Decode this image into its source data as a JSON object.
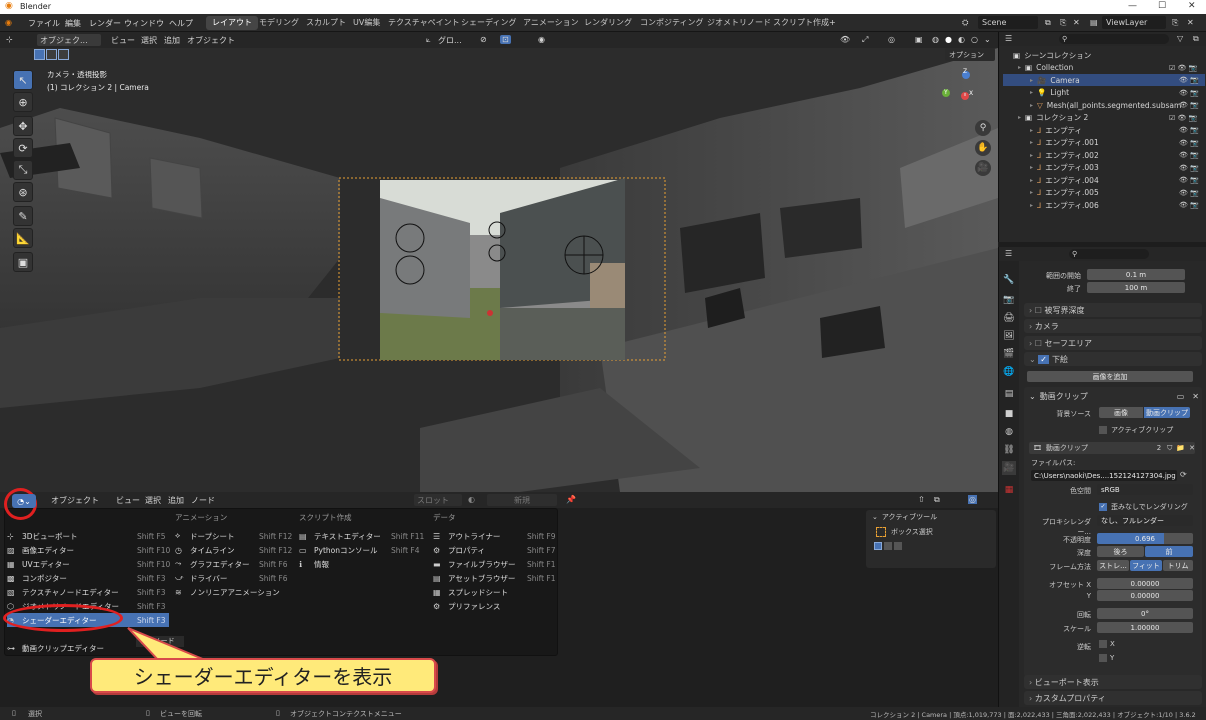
{
  "titlebar": {
    "app": "Blender"
  },
  "topmenu": {
    "file": "ファイル",
    "edit": "編集",
    "render": "レンダー",
    "window": "ウィンドウ",
    "help": "ヘルプ"
  },
  "workspaces": [
    "レイアウト",
    "モデリング",
    "スカルプト",
    "UV編集",
    "テクスチャペイント",
    "シェーディング",
    "アニメーション",
    "レンダリング",
    "コンポジティング",
    "ジオメトリノード",
    "スクリプト作成"
  ],
  "scene": {
    "name": "Scene",
    "viewlayer": "ViewLayer",
    "plus": "+"
  },
  "viewport": {
    "mode": "オブジェク...",
    "view": "ビュー",
    "select": "選択",
    "add": "追加",
    "object": "オブジェクト",
    "transform": "グロ...",
    "options": "オプション",
    "info_line1": "カメラ・透視投影",
    "info_line2": "(1) コレクション 2 | Camera"
  },
  "outliner": {
    "rows": [
      {
        "label": "シーンコレクション",
        "indent": 0
      },
      {
        "label": "Collection",
        "indent": 1
      },
      {
        "label": "Camera",
        "indent": 2,
        "selected": true
      },
      {
        "label": "Light",
        "indent": 2
      },
      {
        "label": "Mesh(all_points.segmented.subsam",
        "indent": 2
      },
      {
        "label": "コレクション 2",
        "indent": 1
      },
      {
        "label": "エンプティ",
        "indent": 2
      },
      {
        "label": "エンプティ.001",
        "indent": 2
      },
      {
        "label": "エンプティ.002",
        "indent": 2
      },
      {
        "label": "エンプティ.003",
        "indent": 2
      },
      {
        "label": "エンプティ.004",
        "indent": 2
      },
      {
        "label": "エンプティ.005",
        "indent": 2
      },
      {
        "label": "エンプティ.006",
        "indent": 2
      }
    ]
  },
  "props": {
    "clip_start_label": "範囲の開始",
    "clip_start": "0.1 m",
    "clip_end_label": "終了",
    "clip_end": "100 m",
    "dof": "被写界深度",
    "camera": "カメラ",
    "safe": "セーフエリア",
    "bg": "下絵",
    "add_image": "画像を追加",
    "movieclip": "動画クリップ",
    "bgsource": "背景ソース",
    "src_image": "画像",
    "src_clip": "動画クリップ",
    "active_clip": "アクティブクリップ",
    "clip_name": "動画クリップ",
    "clip_users": "2",
    "filepath_label": "ファイルパス:",
    "filepath": "C:\\Users\\naoki\\Des....152124127304.jpg",
    "colorspace_label": "色空間",
    "colorspace": "sRGB",
    "undistort": "歪みなしでレンダリング",
    "proxy_label": "プロキシレンダー...",
    "proxy": "なし、フルレンダー",
    "opacity_label": "不透明度",
    "opacity": "0.696",
    "depth_label": "深度",
    "depth_back": "後ろ",
    "depth_front": "前",
    "frame_label": "フレーム方法",
    "frame_stretch": "ストレ...",
    "frame_fit": "フィット",
    "frame_crop": "トリム",
    "offx_label": "オフセット X",
    "offx": "0.00000",
    "offy_label": "Y",
    "offy": "0.00000",
    "rot_label": "回転",
    "rot": "0°",
    "scale_label": "スケール",
    "scale": "1.00000",
    "flip_label": "逆転",
    "flipx": "X",
    "flipy": "Y",
    "vpdisplay": "ビューポート表示",
    "customprops": "カスタムプロパティ"
  },
  "bottom": {
    "object": "オブジェクト",
    "view": "ビュー",
    "select": "選択",
    "add": "追加",
    "node": "ノード",
    "slot": "スロット",
    "new": "新規",
    "activetool": "アクティブツール",
    "boxselect": "ボックス選択"
  },
  "editor_menu": {
    "col1": [
      {
        "label": "3Dビューポート",
        "sc": "Shift F5",
        "icon": "viewport-icon"
      },
      {
        "label": "画像エディター",
        "sc": "Shift F10",
        "icon": "image-icon"
      },
      {
        "label": "UVエディター",
        "sc": "Shift F10",
        "icon": "uv-icon"
      },
      {
        "label": "コンポジター",
        "sc": "Shift F3",
        "icon": "compositor-icon"
      },
      {
        "label": "テクスチャノードエディター",
        "sc": "Shift F3",
        "icon": "texture-node-icon"
      },
      {
        "label": "ジオメトリノードエディター",
        "sc": "Shift F3",
        "icon": "geometry-node-icon"
      },
      {
        "label": "シェーダーエディター",
        "sc": "Shift F3",
        "icon": "shader-icon",
        "hl": true
      },
      {
        "label": "",
        "sc": "",
        "icon": ""
      },
      {
        "label": "動画クリップエディター",
        "sc": "",
        "icon": "clip-icon"
      }
    ],
    "col2_head": "アニメーション",
    "col2": [
      {
        "label": "ドープシート",
        "sc": "Shift F12",
        "icon": "dopesheet-icon"
      },
      {
        "label": "タイムライン",
        "sc": "Shift F12",
        "icon": "timeline-icon"
      },
      {
        "label": "グラフエディター",
        "sc": "Shift F6",
        "icon": "graph-icon"
      },
      {
        "label": "ドライバー",
        "sc": "Shift F6",
        "icon": "driver-icon"
      },
      {
        "label": "ノンリニアアニメーション",
        "sc": "",
        "icon": "nla-icon"
      }
    ],
    "col3_head": "スクリプト作成",
    "col3": [
      {
        "label": "テキストエディター",
        "sc": "Shift F11",
        "icon": "text-icon"
      },
      {
        "label": "Pythonコンソール",
        "sc": "Shift F4",
        "icon": "console-icon"
      },
      {
        "label": "情報",
        "sc": "",
        "icon": "info-icon"
      }
    ],
    "col4_head": "データ",
    "col4": [
      {
        "label": "アウトライナー",
        "sc": "Shift F9",
        "icon": "outliner-icon"
      },
      {
        "label": "プロパティ",
        "sc": "Shift F7",
        "icon": "properties-icon"
      },
      {
        "label": "ファイルブラウザー",
        "sc": "Shift F1",
        "icon": "file-icon"
      },
      {
        "label": "アセットブラウザー",
        "sc": "Shift F1",
        "icon": "asset-icon"
      },
      {
        "label": "スプレッドシート",
        "sc": "",
        "icon": "spreadsheet-icon"
      },
      {
        "label": "プリファレンス",
        "sc": "",
        "icon": "prefs-icon"
      }
    ],
    "tooltip": "ダーノード"
  },
  "callout": "シェーダーエディターを表示",
  "status": {
    "select": "選択",
    "rotate": "ビューを回転",
    "ctx": "オブジェクトコンテクストメニュー",
    "stats": "コレクション 2 | Camera | 頂点:1,019,773 | 面:2,022,433 | 三角面:2,022,433 | オブジェクト:1/10 | 3.6.2"
  }
}
